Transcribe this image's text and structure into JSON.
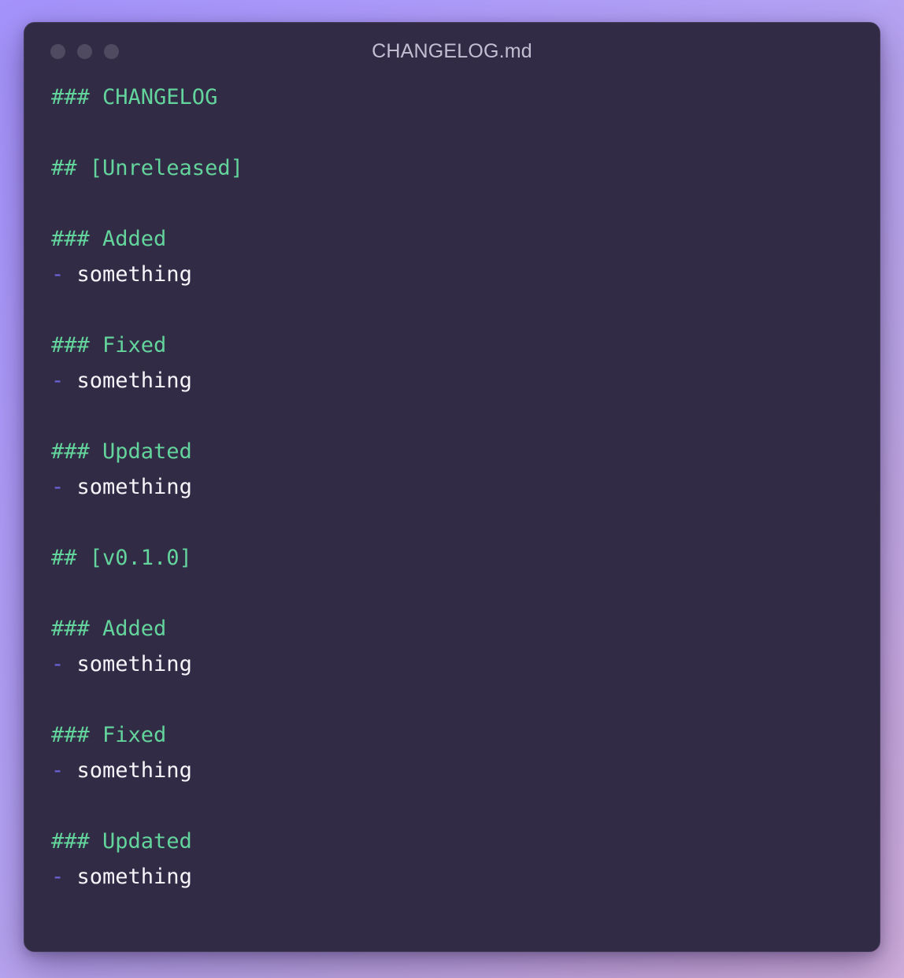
{
  "window": {
    "title": "CHANGELOG.md",
    "traffic_lights": [
      {
        "name": "close-button",
        "color": "#504a60"
      },
      {
        "name": "minimize-button",
        "color": "#504a60"
      },
      {
        "name": "maximize-button",
        "color": "#504a60"
      }
    ],
    "background": "#322b45",
    "border": "#433c59"
  },
  "page": {
    "background_gradient_from": "#a493fb",
    "background_gradient_to": "#cfaddc"
  },
  "colors": {
    "heading": "#63d49c",
    "bullet_dash": "#6d64da",
    "body_text": "#f6f5fa",
    "title_text": "#c3bdd2"
  },
  "document": {
    "filename": "CHANGELOG.md",
    "language": "markdown",
    "lines": [
      {
        "type": "heading",
        "text": "### CHANGELOG"
      },
      {
        "type": "blank",
        "text": ""
      },
      {
        "type": "heading",
        "text": "## [Unreleased]"
      },
      {
        "type": "blank",
        "text": ""
      },
      {
        "type": "heading",
        "text": "### Added"
      },
      {
        "type": "item",
        "dash": "-",
        "text": " something"
      },
      {
        "type": "blank",
        "text": ""
      },
      {
        "type": "heading",
        "text": "### Fixed"
      },
      {
        "type": "item",
        "dash": "-",
        "text": " something"
      },
      {
        "type": "blank",
        "text": ""
      },
      {
        "type": "heading",
        "text": "### Updated"
      },
      {
        "type": "item",
        "dash": "-",
        "text": " something"
      },
      {
        "type": "blank",
        "text": ""
      },
      {
        "type": "heading",
        "text": "## [v0.1.0]"
      },
      {
        "type": "blank",
        "text": ""
      },
      {
        "type": "heading",
        "text": "### Added"
      },
      {
        "type": "item",
        "dash": "-",
        "text": " something"
      },
      {
        "type": "blank",
        "text": ""
      },
      {
        "type": "heading",
        "text": "### Fixed"
      },
      {
        "type": "item",
        "dash": "-",
        "text": " something"
      },
      {
        "type": "blank",
        "text": ""
      },
      {
        "type": "heading",
        "text": "### Updated"
      },
      {
        "type": "item",
        "dash": "-",
        "text": " something"
      }
    ]
  }
}
